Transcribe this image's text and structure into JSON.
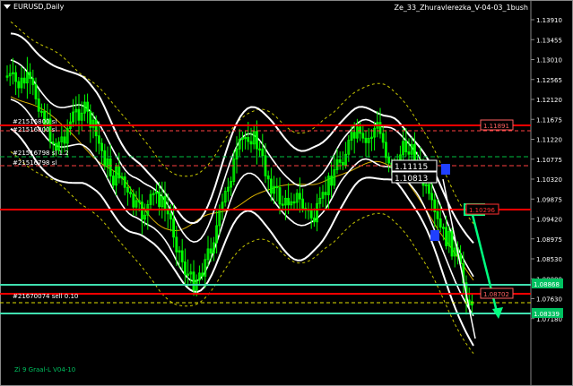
{
  "window": {
    "symbol_title": "EURUSD,Daily",
    "expert_name": "Ze_33_Zhuravlerezka_V-04-03_1bush",
    "footer_label": "Zi 9 Graal-L V04-10"
  },
  "colors": {
    "background": "#000000",
    "candle": "#00ff00",
    "band": "#ffffff",
    "red_line": "#ff0000",
    "green_level": "#00ff7f",
    "aqua_level": "#40e0b0",
    "yellow_dash": "#c8c800",
    "axis_text": "#ffffff"
  },
  "price_axis": {
    "ticks": [
      "1.13910",
      "1.13455",
      "1.13010",
      "1.12565",
      "1.12120",
      "1.11675",
      "1.11220",
      "1.10775",
      "1.10320",
      "1.09875",
      "1.09420",
      "1.08975",
      "1.08530",
      "1.08080",
      "1.07630",
      "1.07180"
    ],
    "tags": [
      {
        "text": "1.08868",
        "color": "#00c060"
      },
      {
        "text": "1.08339",
        "color": "#00c060"
      }
    ]
  },
  "order_labels": [
    {
      "text": "#21516800 sl",
      "color": "#ffffff"
    },
    {
      "text": "#21516800 sl",
      "color": "#ffffff"
    },
    {
      "text": "#21516798 sl 1.2",
      "color": "#ffffff"
    },
    {
      "text": "#21516798 sl",
      "color": "#ffffff"
    },
    {
      "text": "#21670074 sell 0.10",
      "color": "#ffffff"
    }
  ],
  "price_boxes": [
    {
      "text": "1.11891",
      "color": "#ff6060"
    },
    {
      "text": "1.10296",
      "color": "#ff3030"
    },
    {
      "text": "1.08702",
      "color": "#ff6060"
    }
  ],
  "info_boxes": [
    {
      "text": "1.11115"
    },
    {
      "text": "1.10813"
    }
  ],
  "icons": {
    "dropdown": "triangle-down-icon",
    "arrow": "green-arrow-icon",
    "markers": "blue-square-icon"
  }
}
